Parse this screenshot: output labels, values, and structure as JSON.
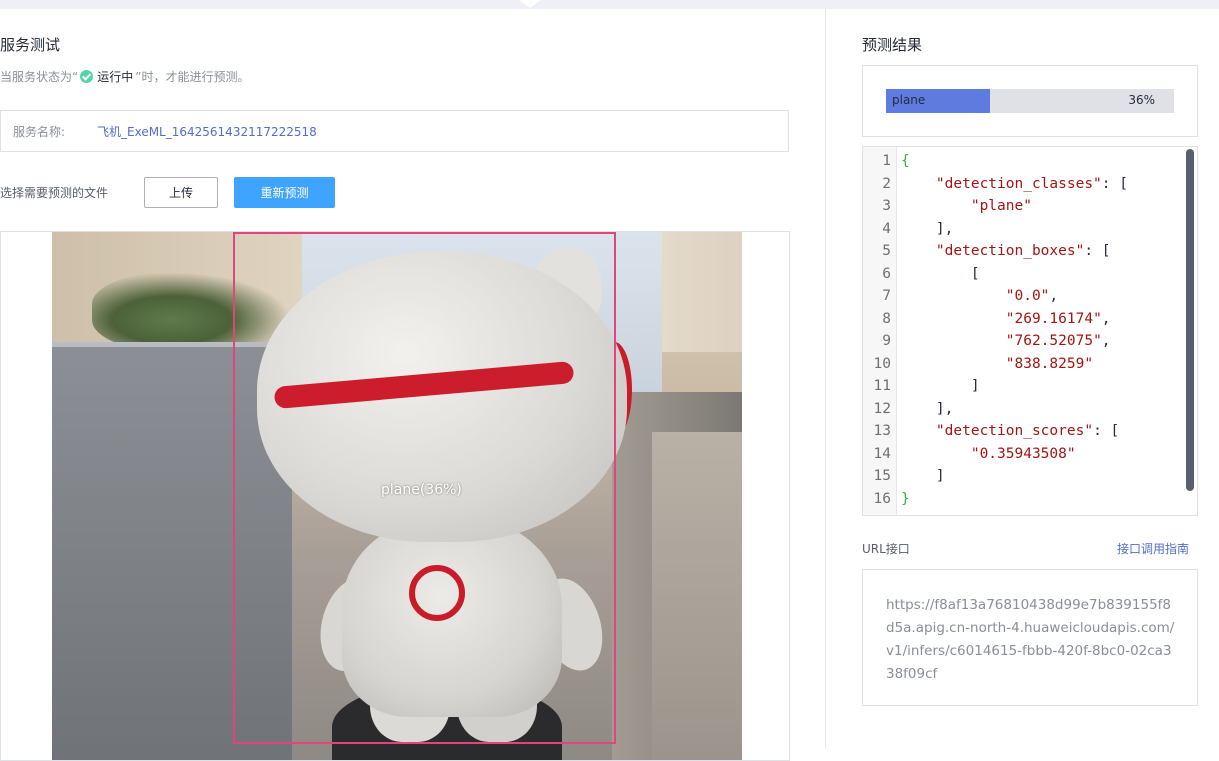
{
  "left": {
    "title": "服务测试",
    "hint": {
      "prefix": "当服务状态为“",
      "status": "运行中",
      "suffix": "”时，才能进行预测。"
    },
    "service": {
      "label": "服务名称:",
      "value": "飞机_ExeML_1642561432117222518"
    },
    "file_label": "选择需要预测的文件",
    "upload_button": "上传",
    "predict_button": "重新预测",
    "detection_label": "plane(36%)"
  },
  "right": {
    "title": "预测结果",
    "result": {
      "class": "plane",
      "percent_text": "36%",
      "fraction": 0.36
    },
    "code_lines": [
      {
        "n": "1",
        "text": "{"
      },
      {
        "n": "2",
        "text": "    \"detection_classes\": ["
      },
      {
        "n": "3",
        "text": "        \"plane\""
      },
      {
        "n": "4",
        "text": "    ],"
      },
      {
        "n": "5",
        "text": "    \"detection_boxes\": ["
      },
      {
        "n": "6",
        "text": "        ["
      },
      {
        "n": "7",
        "text": "            \"0.0\","
      },
      {
        "n": "8",
        "text": "            \"269.16174\","
      },
      {
        "n": "9",
        "text": "            \"762.52075\","
      },
      {
        "n": "10",
        "text": "            \"838.8259\""
      },
      {
        "n": "11",
        "text": "        ]"
      },
      {
        "n": "12",
        "text": "    ],"
      },
      {
        "n": "13",
        "text": "    \"detection_scores\": ["
      },
      {
        "n": "14",
        "text": "        \"0.35943508\""
      },
      {
        "n": "15",
        "text": "    ]"
      },
      {
        "n": "16",
        "text": "}"
      }
    ],
    "url_label": "URL接口",
    "url_guide": "接口调用指南",
    "url_value": "https://f8af13a76810438d99e7b839155f8d5a.apig.cn-north-4.huaweicloudapis.com/v1/infers/c6014615-fbbb-420f-8bc0-02ca338f09cf"
  },
  "colors": {
    "accent": "#3fa4ff",
    "bar": "#5e7ce0",
    "bbox": "#e0457b",
    "status_ok": "#50d4ab"
  }
}
